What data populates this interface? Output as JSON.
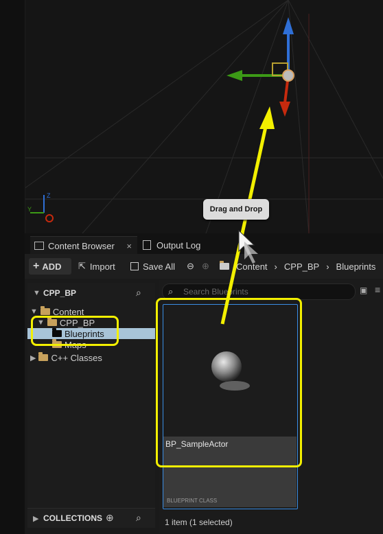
{
  "viewport": {
    "axis_z_label": "Z",
    "axis_y_label": "Y"
  },
  "tabs": [
    {
      "label": "Content Browser",
      "close": "×"
    },
    {
      "label": "Output Log"
    }
  ],
  "toolbar": {
    "add_label": "ADD",
    "import_label": "Import",
    "save_all_label": "Save All",
    "breadcrumb": [
      "Content",
      "CPP_BP",
      "Blueprints"
    ],
    "separator": "›"
  },
  "sidebar": {
    "header": "CPP_BP",
    "tree": [
      {
        "label": "Content"
      },
      {
        "label": "CPP_BP"
      },
      {
        "label": "Blueprints"
      },
      {
        "label": "Maps"
      },
      {
        "label": "C++ Classes"
      }
    ],
    "collections_label": "COLLECTIONS"
  },
  "search": {
    "placeholder": "Search Blueprints"
  },
  "asset": {
    "name": "BP_SampleActor",
    "type": "BLUEPRINT CLASS"
  },
  "status": "1 item (1 selected)",
  "tooltip": "Drag and Drop",
  "colors": {
    "highlight": "#f3f000",
    "selection_border": "#3a8ee6",
    "gizmo_x": "#c62a0e",
    "gizmo_y": "#3c9a16",
    "gizmo_z": "#2f6fd6"
  }
}
